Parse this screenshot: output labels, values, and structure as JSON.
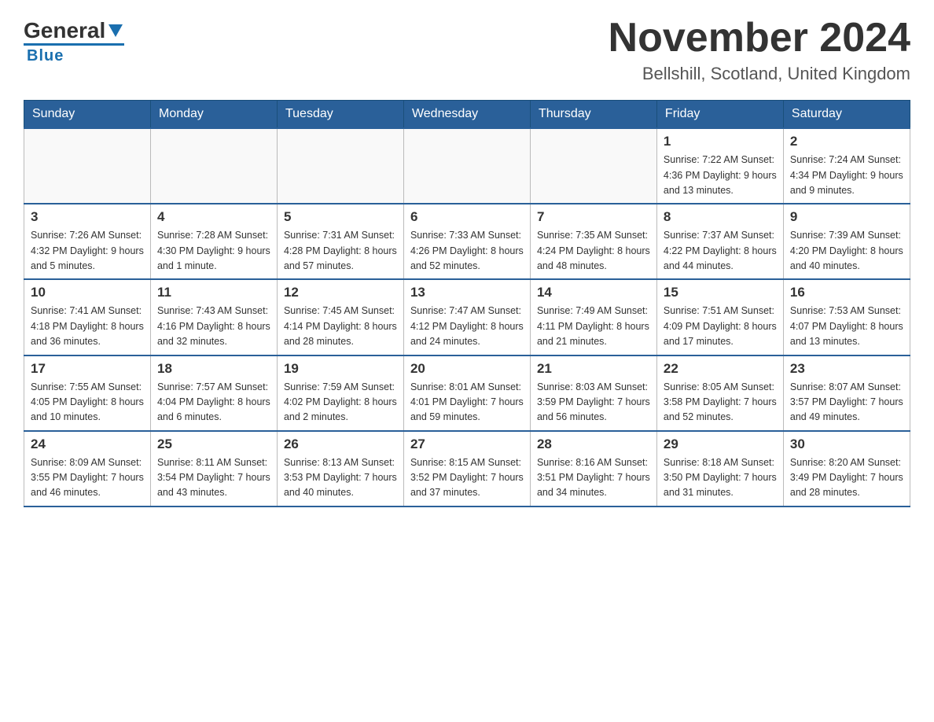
{
  "header": {
    "logo_general": "General",
    "logo_blue": "Blue",
    "month_title": "November 2024",
    "location": "Bellshill, Scotland, United Kingdom"
  },
  "days_of_week": [
    "Sunday",
    "Monday",
    "Tuesday",
    "Wednesday",
    "Thursday",
    "Friday",
    "Saturday"
  ],
  "weeks": [
    [
      {
        "day": "",
        "info": ""
      },
      {
        "day": "",
        "info": ""
      },
      {
        "day": "",
        "info": ""
      },
      {
        "day": "",
        "info": ""
      },
      {
        "day": "",
        "info": ""
      },
      {
        "day": "1",
        "info": "Sunrise: 7:22 AM\nSunset: 4:36 PM\nDaylight: 9 hours\nand 13 minutes."
      },
      {
        "day": "2",
        "info": "Sunrise: 7:24 AM\nSunset: 4:34 PM\nDaylight: 9 hours\nand 9 minutes."
      }
    ],
    [
      {
        "day": "3",
        "info": "Sunrise: 7:26 AM\nSunset: 4:32 PM\nDaylight: 9 hours\nand 5 minutes."
      },
      {
        "day": "4",
        "info": "Sunrise: 7:28 AM\nSunset: 4:30 PM\nDaylight: 9 hours\nand 1 minute."
      },
      {
        "day": "5",
        "info": "Sunrise: 7:31 AM\nSunset: 4:28 PM\nDaylight: 8 hours\nand 57 minutes."
      },
      {
        "day": "6",
        "info": "Sunrise: 7:33 AM\nSunset: 4:26 PM\nDaylight: 8 hours\nand 52 minutes."
      },
      {
        "day": "7",
        "info": "Sunrise: 7:35 AM\nSunset: 4:24 PM\nDaylight: 8 hours\nand 48 minutes."
      },
      {
        "day": "8",
        "info": "Sunrise: 7:37 AM\nSunset: 4:22 PM\nDaylight: 8 hours\nand 44 minutes."
      },
      {
        "day": "9",
        "info": "Sunrise: 7:39 AM\nSunset: 4:20 PM\nDaylight: 8 hours\nand 40 minutes."
      }
    ],
    [
      {
        "day": "10",
        "info": "Sunrise: 7:41 AM\nSunset: 4:18 PM\nDaylight: 8 hours\nand 36 minutes."
      },
      {
        "day": "11",
        "info": "Sunrise: 7:43 AM\nSunset: 4:16 PM\nDaylight: 8 hours\nand 32 minutes."
      },
      {
        "day": "12",
        "info": "Sunrise: 7:45 AM\nSunset: 4:14 PM\nDaylight: 8 hours\nand 28 minutes."
      },
      {
        "day": "13",
        "info": "Sunrise: 7:47 AM\nSunset: 4:12 PM\nDaylight: 8 hours\nand 24 minutes."
      },
      {
        "day": "14",
        "info": "Sunrise: 7:49 AM\nSunset: 4:11 PM\nDaylight: 8 hours\nand 21 minutes."
      },
      {
        "day": "15",
        "info": "Sunrise: 7:51 AM\nSunset: 4:09 PM\nDaylight: 8 hours\nand 17 minutes."
      },
      {
        "day": "16",
        "info": "Sunrise: 7:53 AM\nSunset: 4:07 PM\nDaylight: 8 hours\nand 13 minutes."
      }
    ],
    [
      {
        "day": "17",
        "info": "Sunrise: 7:55 AM\nSunset: 4:05 PM\nDaylight: 8 hours\nand 10 minutes."
      },
      {
        "day": "18",
        "info": "Sunrise: 7:57 AM\nSunset: 4:04 PM\nDaylight: 8 hours\nand 6 minutes."
      },
      {
        "day": "19",
        "info": "Sunrise: 7:59 AM\nSunset: 4:02 PM\nDaylight: 8 hours\nand 2 minutes."
      },
      {
        "day": "20",
        "info": "Sunrise: 8:01 AM\nSunset: 4:01 PM\nDaylight: 7 hours\nand 59 minutes."
      },
      {
        "day": "21",
        "info": "Sunrise: 8:03 AM\nSunset: 3:59 PM\nDaylight: 7 hours\nand 56 minutes."
      },
      {
        "day": "22",
        "info": "Sunrise: 8:05 AM\nSunset: 3:58 PM\nDaylight: 7 hours\nand 52 minutes."
      },
      {
        "day": "23",
        "info": "Sunrise: 8:07 AM\nSunset: 3:57 PM\nDaylight: 7 hours\nand 49 minutes."
      }
    ],
    [
      {
        "day": "24",
        "info": "Sunrise: 8:09 AM\nSunset: 3:55 PM\nDaylight: 7 hours\nand 46 minutes."
      },
      {
        "day": "25",
        "info": "Sunrise: 8:11 AM\nSunset: 3:54 PM\nDaylight: 7 hours\nand 43 minutes."
      },
      {
        "day": "26",
        "info": "Sunrise: 8:13 AM\nSunset: 3:53 PM\nDaylight: 7 hours\nand 40 minutes."
      },
      {
        "day": "27",
        "info": "Sunrise: 8:15 AM\nSunset: 3:52 PM\nDaylight: 7 hours\nand 37 minutes."
      },
      {
        "day": "28",
        "info": "Sunrise: 8:16 AM\nSunset: 3:51 PM\nDaylight: 7 hours\nand 34 minutes."
      },
      {
        "day": "29",
        "info": "Sunrise: 8:18 AM\nSunset: 3:50 PM\nDaylight: 7 hours\nand 31 minutes."
      },
      {
        "day": "30",
        "info": "Sunrise: 8:20 AM\nSunset: 3:49 PM\nDaylight: 7 hours\nand 28 minutes."
      }
    ]
  ]
}
